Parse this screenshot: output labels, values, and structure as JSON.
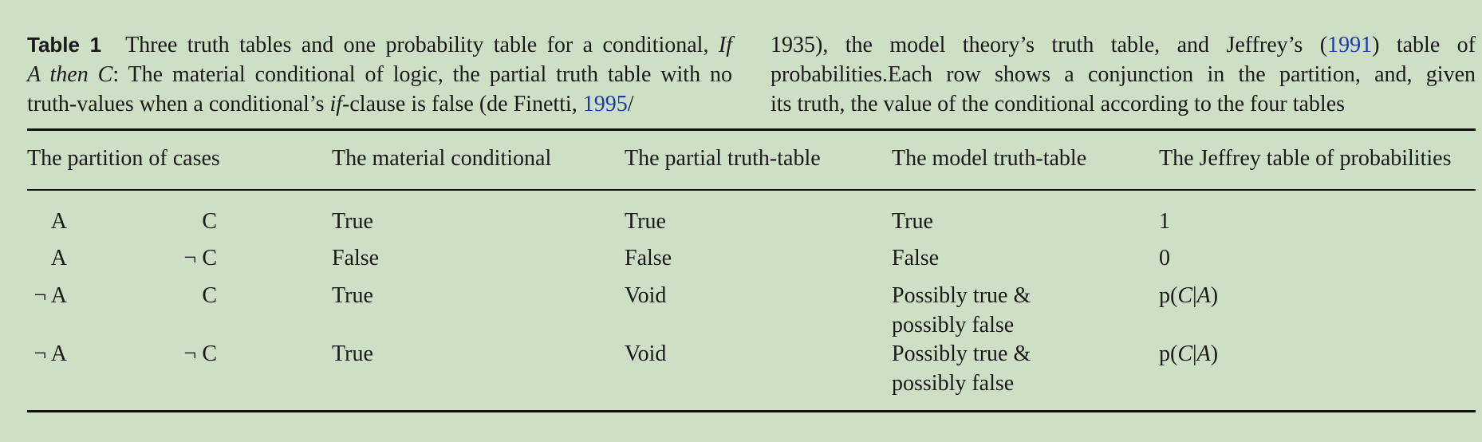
{
  "caption": {
    "label": "Table 1",
    "left_lines": [
      [
        "Three truth tables and one probability table for a conditional, ",
        {
          "i": "If"
        }
      ],
      [
        {
          "i": "A then C"
        },
        ": The material conditional of logic, the partial truth table with no"
      ],
      [
        "truth-values when a conditional’s ",
        {
          "i": "if"
        },
        "-clause is false (de Finetti, ",
        {
          "ref": "1995"
        },
        "/"
      ]
    ],
    "right_lines": [
      [
        "1935), the model theory’s truth table, and Jeffrey’s (",
        {
          "ref": "1991"
        },
        ") table of"
      ],
      [
        "probabilities.Each row shows a conjunction in the partition, and, given"
      ],
      [
        "its truth, the value of the conditional according to the four tables"
      ]
    ]
  },
  "table": {
    "headers": {
      "partition": "The partition of cases",
      "material": "The material conditional",
      "partial": "The partial truth-table",
      "model": "The model truth-table",
      "jeffrey": "The Jeffrey table of probabilities"
    },
    "rows": [
      {
        "a": "A",
        "c": "C",
        "material": "True",
        "partial": "True",
        "model": [
          "True"
        ],
        "jeffrey": "1"
      },
      {
        "a": "A",
        "c": "¬ C",
        "material": "False",
        "partial": "False",
        "model": [
          "False"
        ],
        "jeffrey": "0"
      },
      {
        "a": "¬ A",
        "c": "C",
        "material": "True",
        "partial": "Void",
        "model": [
          "Possibly true &",
          "possibly false"
        ],
        "jeffrey": "p(C|A)"
      },
      {
        "a": "¬ A",
        "c": "¬ C",
        "material": "True",
        "partial": "Void",
        "model": [
          "Possibly true &",
          "possibly false"
        ],
        "jeffrey": "p(C|A)"
      }
    ]
  },
  "colors": {
    "background": "#cddfc4",
    "text": "#1a1a1a",
    "reference_link": "#1e3aa8"
  }
}
